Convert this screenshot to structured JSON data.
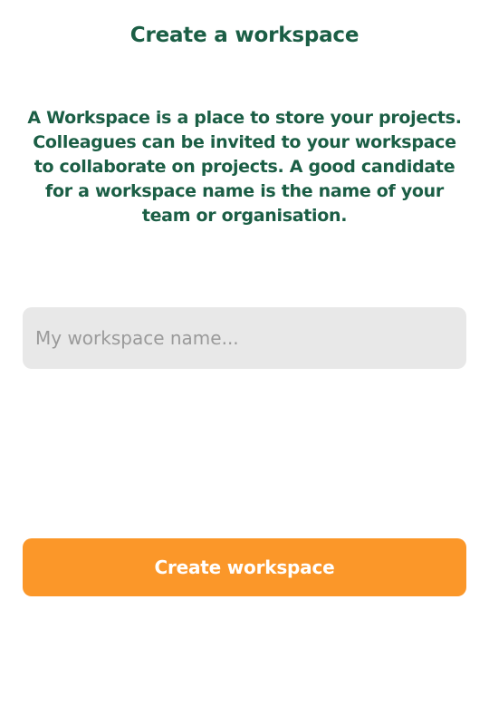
{
  "page": {
    "title": "Create a workspace",
    "description": "A Workspace is a place to store your projects. Colleagues can be invited to your workspace to collaborate on projects. A good candidate for a workspace name is the name of your team or organisation."
  },
  "form": {
    "name_placeholder": "My workspace name...",
    "name_value": "",
    "submit_label": "Create workspace"
  },
  "colors": {
    "heading": "#1b5e45",
    "input_background": "#e8e8e8",
    "accent_button": "#fb9729"
  }
}
